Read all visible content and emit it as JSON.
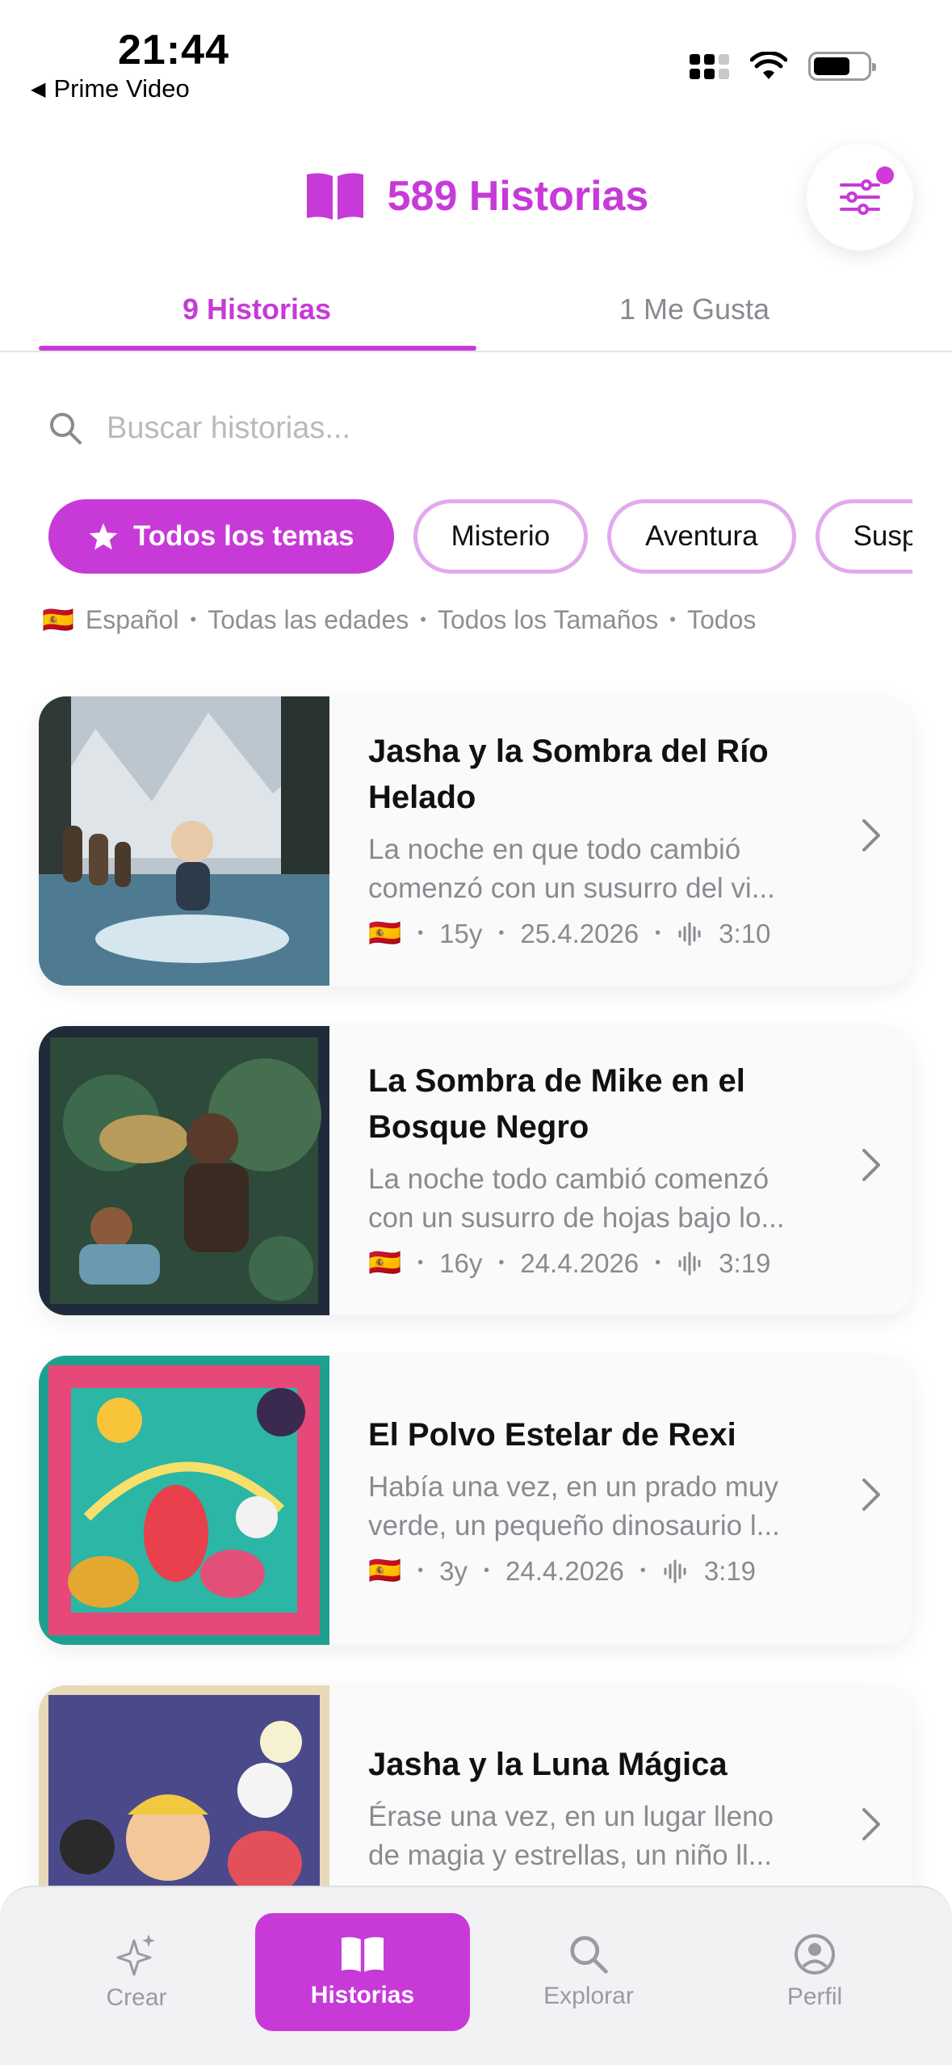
{
  "status_bar": {
    "time": "21:44",
    "back_app": "Prime Video"
  },
  "header": {
    "title": "589 Historias",
    "icon": "book-icon",
    "filter_icon": "sliders-icon"
  },
  "tabs": [
    {
      "label": "9 Historias",
      "active": true
    },
    {
      "label": "1 Me Gusta",
      "active": false
    }
  ],
  "search": {
    "placeholder": "Buscar historias...",
    "value": ""
  },
  "chips": [
    {
      "label": "Todos los temas",
      "active": true,
      "icon": "star-icon"
    },
    {
      "label": "Misterio",
      "active": false
    },
    {
      "label": "Aventura",
      "active": false
    },
    {
      "label": "Suspenso",
      "active": false
    }
  ],
  "filters": {
    "flag": "🇪🇸",
    "language": "Español",
    "ages": "Todas las edades",
    "sizes": "Todos los Tamaños",
    "other": "Todos"
  },
  "stories": [
    {
      "title": "Jasha y la Sombra del Río Helado",
      "excerpt": "La noche en que todo cambió\ncomenzó con un susurro del vi...",
      "flag": "🇪🇸",
      "age": "15y",
      "date": "25.4.2026",
      "duration": "3:10"
    },
    {
      "title": "La Sombra de Mike en el Bosque Negro",
      "excerpt": "La noche todo cambió comenzó\ncon un susurro de hojas bajo lo...",
      "flag": "🇪🇸",
      "age": "16y",
      "date": "24.4.2026",
      "duration": "3:19"
    },
    {
      "title": "El Polvo Estelar de Rexi",
      "excerpt": "Había una vez, en un prado muy\nverde, un pequeño dinosaurio l...",
      "flag": "🇪🇸",
      "age": "3y",
      "date": "24.4.2026",
      "duration": "3:19"
    },
    {
      "title": "Jasha y la Luna Mágica",
      "excerpt": "Érase una vez, en un lugar lleno\nde magia y estrellas, un niño ll..."
    }
  ],
  "bottom_nav": [
    {
      "label": "Crear",
      "icon": "sparkles-icon",
      "active": false
    },
    {
      "label": "Historias",
      "icon": "book-icon",
      "active": true
    },
    {
      "label": "Explorar",
      "icon": "search-icon",
      "active": false
    },
    {
      "label": "Perfil",
      "icon": "profile-icon",
      "active": false
    }
  ],
  "colors": {
    "accent": "#c73ad8",
    "chip_border": "#e3a8ef",
    "muted": "#8a8a90"
  }
}
